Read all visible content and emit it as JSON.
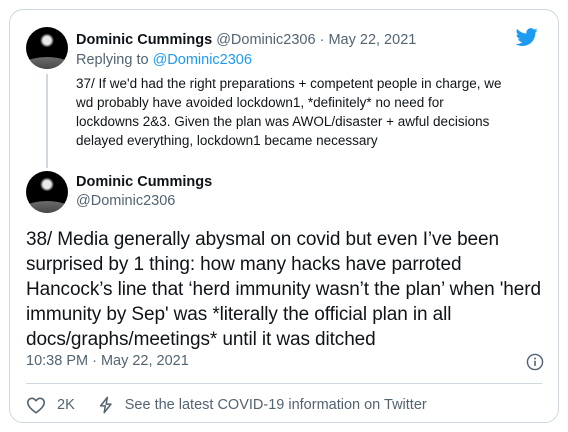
{
  "quoted_tweet": {
    "author_name": "Dominic Cummings",
    "author_handle": "@Dominic2306",
    "separator": "·",
    "date": "May 22, 2021",
    "replying_prefix": "Replying to",
    "replying_handle": "@Dominic2306",
    "text": "37/ If we'd had the right preparations + competent people in charge, we wd probably have avoided lockdown1, *definitely* no need for lockdowns 2&3. Given the plan was AWOL/disaster + awful decisions delayed everything, lockdown1 became necessary"
  },
  "main_tweet": {
    "author_name": "Dominic Cummings",
    "author_handle": "@Dominic2306",
    "text": "38/ Media generally abysmal on covid but even I’ve been surprised by 1 thing: how many hacks have parroted Hancock’s line that ‘herd immunity wasn’t the plan’ when 'herd immunity by Sep' was *literally the official plan in all docs/graphs/meetings* until it was ditched",
    "time": "10:38 PM · May 22, 2021"
  },
  "actions": {
    "like_count": "2K",
    "covid_link": "See the latest COVID-19 information on Twitter"
  },
  "colors": {
    "brand_blue": "#1d9bf0",
    "secondary_text": "#536471",
    "border": "#cfd9de"
  },
  "icons": [
    "twitter-bird-icon",
    "info-icon",
    "heart-icon",
    "lightning-bolt-icon"
  ]
}
